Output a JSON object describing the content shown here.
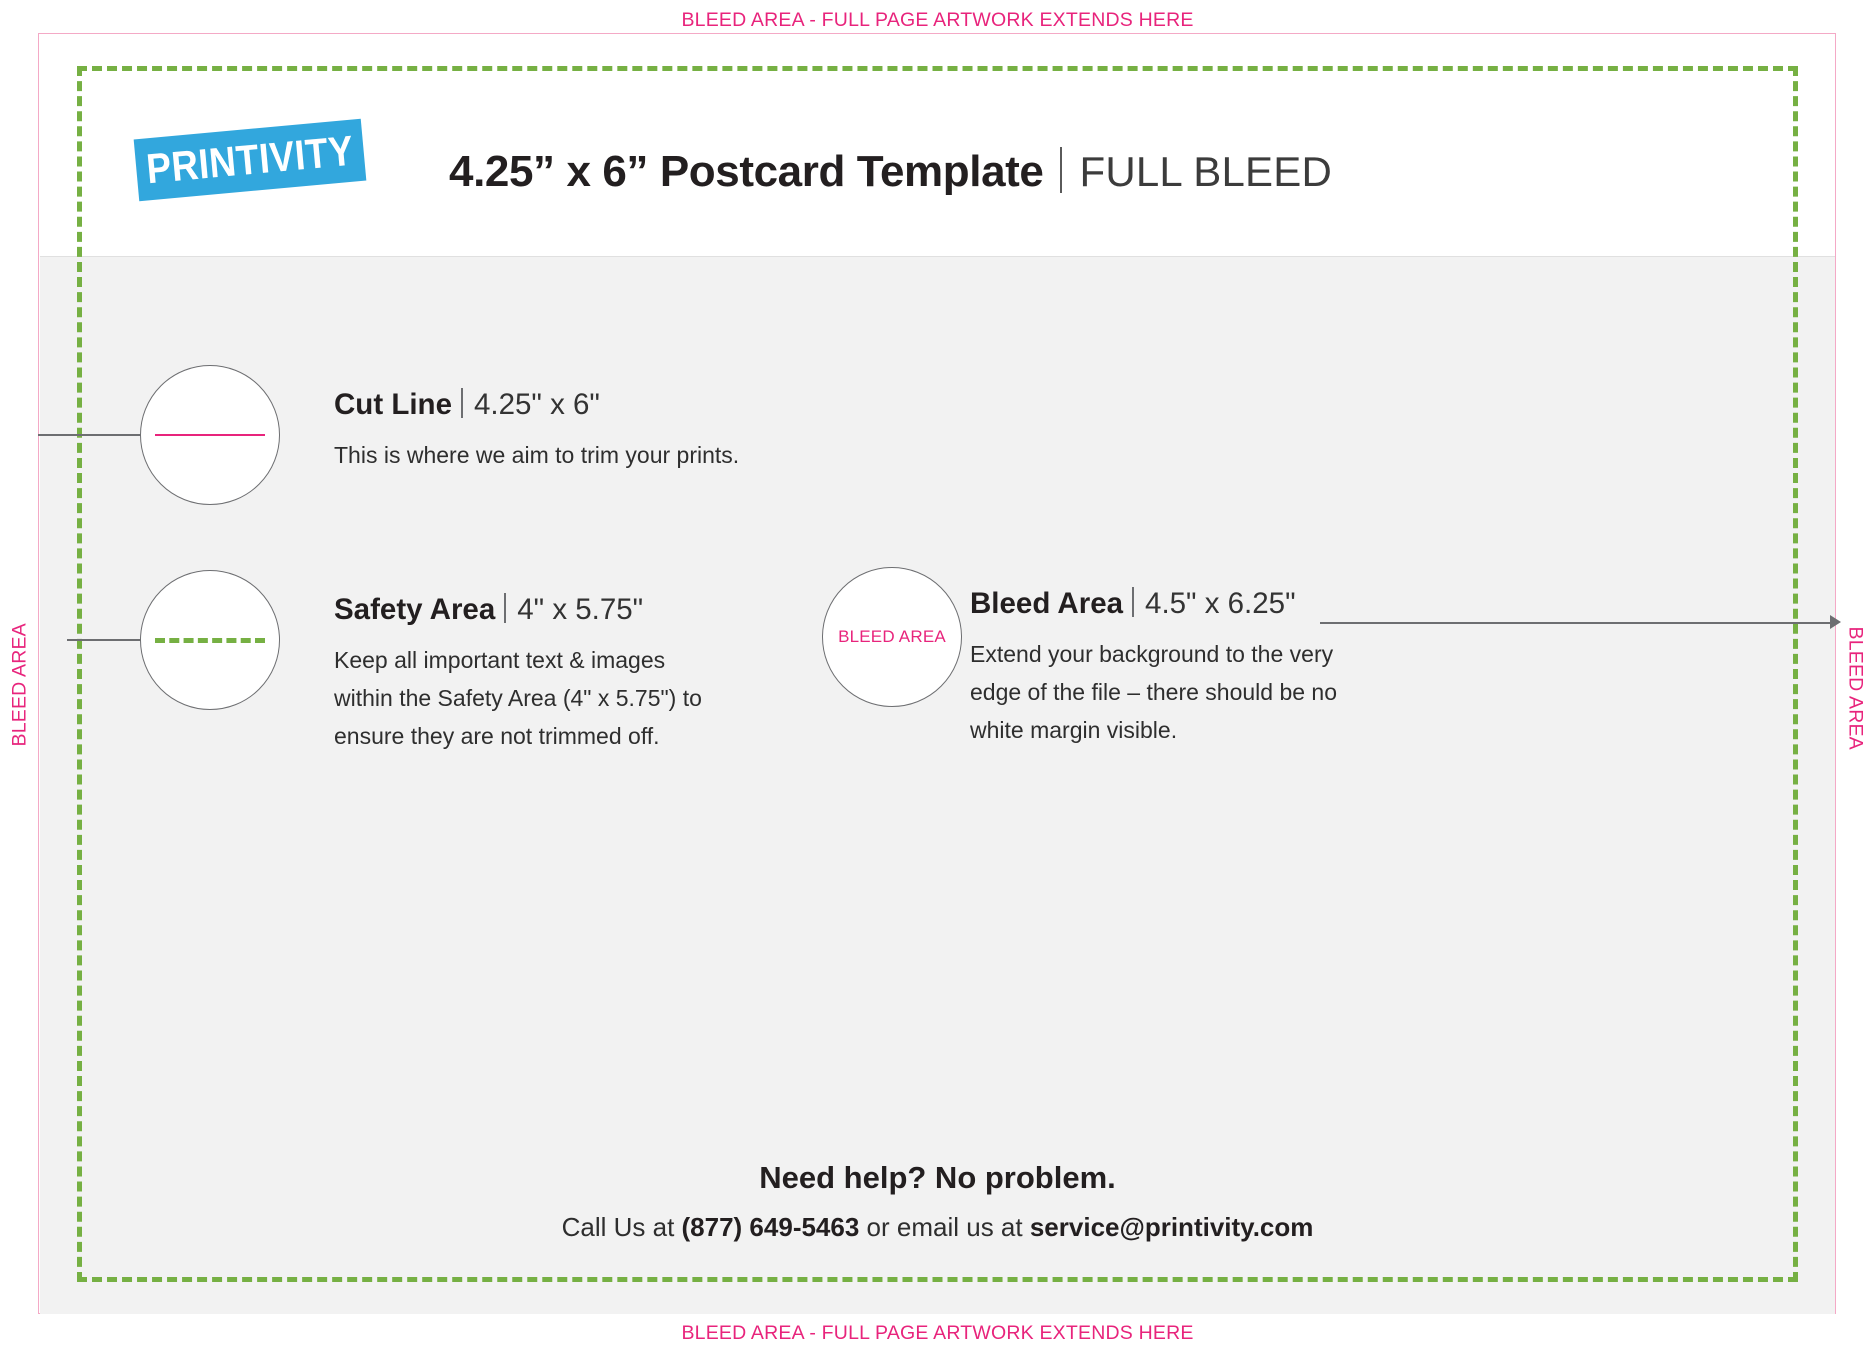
{
  "document": {
    "title": "4.25” x 6” Postcard Template",
    "title_divider_label": "FULL BLEED",
    "logo_text": "PRINTIVITY"
  },
  "bleed_labels": {
    "top": "BLEED AREA - FULL PAGE ARTWORK EXTENDS HERE",
    "bottom": "BLEED AREA - FULL PAGE ARTWORK EXTENDS HERE",
    "left": "BLEED AREA",
    "right": "BLEED AREA"
  },
  "callouts": [
    {
      "key": "cut_line",
      "title": "Cut Line",
      "dimensions": "4.25\" x 6\"",
      "body": "This is where we aim to trim your prints.",
      "swatch_type": "solid-line",
      "swatch_color": "#e8247c"
    },
    {
      "key": "safety_area",
      "title": "Safety Area",
      "dimensions": "4\" x 5.75\"",
      "body": "Keep all important text & images within the Safety Area (4\" x 5.75\") to ensure they are not trimmed off.",
      "swatch_type": "dashed-line",
      "swatch_color": "#76b043"
    },
    {
      "key": "bleed_area",
      "title": "Bleed Area",
      "dimensions": "4.5\" x 6.25\"",
      "body": "Extend your background to the very edge of the file – there should be no white margin visible.",
      "swatch_type": "text",
      "swatch_text": "BLEED AREA",
      "swatch_color": "#e8247c"
    }
  ],
  "footer": {
    "heading": "Need help? No problem.",
    "call_prefix": "Call Us at ",
    "phone": "(877) 649-5463",
    "call_middle": " or email us at ",
    "email": "service@printivity.com"
  },
  "colors": {
    "bleed_pink": "#e8247c",
    "bleed_border_pink": "#f4a9c6",
    "safety_green": "#76b043",
    "logo_blue": "#32a7dd",
    "body_gray": "#f2f2f2",
    "text_dark": "#231f20"
  }
}
